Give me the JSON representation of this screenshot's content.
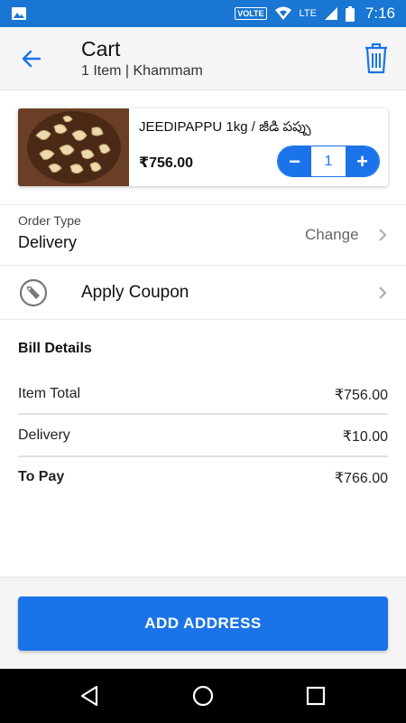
{
  "status_bar": {
    "network_badge": "VOLTE",
    "lte_label": "LTE",
    "time": "7:16"
  },
  "header": {
    "title": "Cart",
    "subtitle": "1 Item | Khammam",
    "back_icon": "arrow-left-icon",
    "delete_icon": "trash-icon"
  },
  "cart_item": {
    "name": "JEEDIPAPPU 1kg / జీడి పప్పు",
    "price": "₹756.00",
    "quantity": "1",
    "decrement_label": "−",
    "increment_label": "+"
  },
  "order_type": {
    "label": "Order Type",
    "value": "Delivery",
    "action": "Change"
  },
  "coupon": {
    "label": "Apply Coupon",
    "icon": "tag-icon"
  },
  "bill": {
    "title": "Bill Details",
    "rows": [
      {
        "label": "Item Total",
        "amount": "₹756.00"
      },
      {
        "label": "Delivery",
        "amount": "₹10.00"
      }
    ],
    "total": {
      "label": "To Pay",
      "amount": "₹766.00"
    }
  },
  "footer": {
    "cta_label": "ADD ADDRESS"
  },
  "colors": {
    "primary": "#1a73e8",
    "status_bar": "#1976d2"
  }
}
